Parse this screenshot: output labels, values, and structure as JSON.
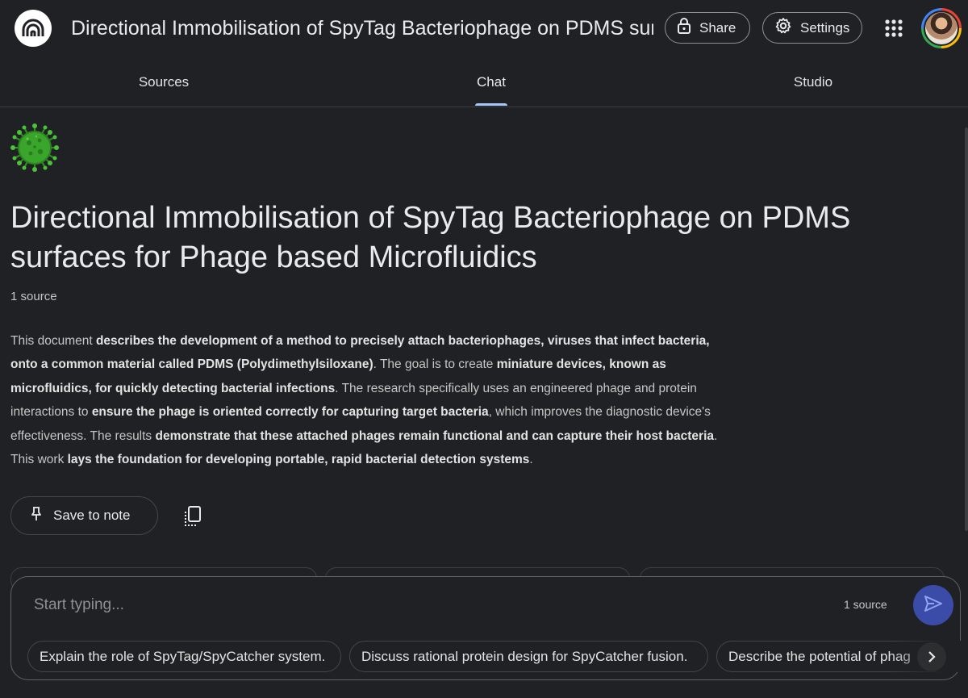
{
  "header": {
    "notebook_title": "Directional Immobilisation of SpyTag Bacteriophage on PDMS surfaces for Phage based Microfluidics",
    "share_label": "Share",
    "settings_label": "Settings",
    "logo_icon": "notebooklm-logo-icon",
    "apps_icon": "apps-grid-icon",
    "avatar": "user-avatar"
  },
  "tabs": [
    {
      "label": "Sources",
      "active": false
    },
    {
      "label": "Chat",
      "active": true
    },
    {
      "label": "Studio",
      "active": false
    }
  ],
  "notebook": {
    "emoji": "virus-icon",
    "heading": "Directional Immobilisation of SpyTag Bacteriophage on PDMS surfaces for Phage based Microfluidics",
    "source_count": "1 source",
    "summary": [
      {
        "t": "This document ",
        "b": false
      },
      {
        "t": "describes the development of a method to precisely attach bacteriophages, viruses that infect bacteria, onto a common material called PDMS (Polydimethylsiloxane)",
        "b": true
      },
      {
        "t": ". The goal is to create ",
        "b": false
      },
      {
        "t": "miniature devices, known as microfluidics, for quickly detecting bacterial infections",
        "b": true
      },
      {
        "t": ". The research specifically uses an engineered phage and protein interactions to ",
        "b": false
      },
      {
        "t": "ensure the phage is oriented correctly for capturing target bacteria",
        "b": true
      },
      {
        "t": ", which improves the diagnostic device's effectiveness. The results ",
        "b": false
      },
      {
        "t": "demonstrate that these attached phages remain functional and can capture their host bacteria",
        "b": true
      },
      {
        "t": ". This work ",
        "b": false
      },
      {
        "t": "lays the foundation for developing portable, rapid bacterial detection systems",
        "b": true
      },
      {
        "t": ".",
        "b": false
      }
    ],
    "save_to_note_label": "Save to note"
  },
  "chat": {
    "placeholder": "Start typing...",
    "source_count": "1 source",
    "suggestions": [
      "Explain the role of SpyTag/SpyCatcher system.",
      "Discuss rational protein design for SpyCatcher fusion.",
      "Describe the potential of phag"
    ]
  },
  "colors": {
    "background": "#202124",
    "accent_underline": "#a8c7fa",
    "send_button": "#3b4ba8",
    "virus_green": "#3aa52b"
  }
}
